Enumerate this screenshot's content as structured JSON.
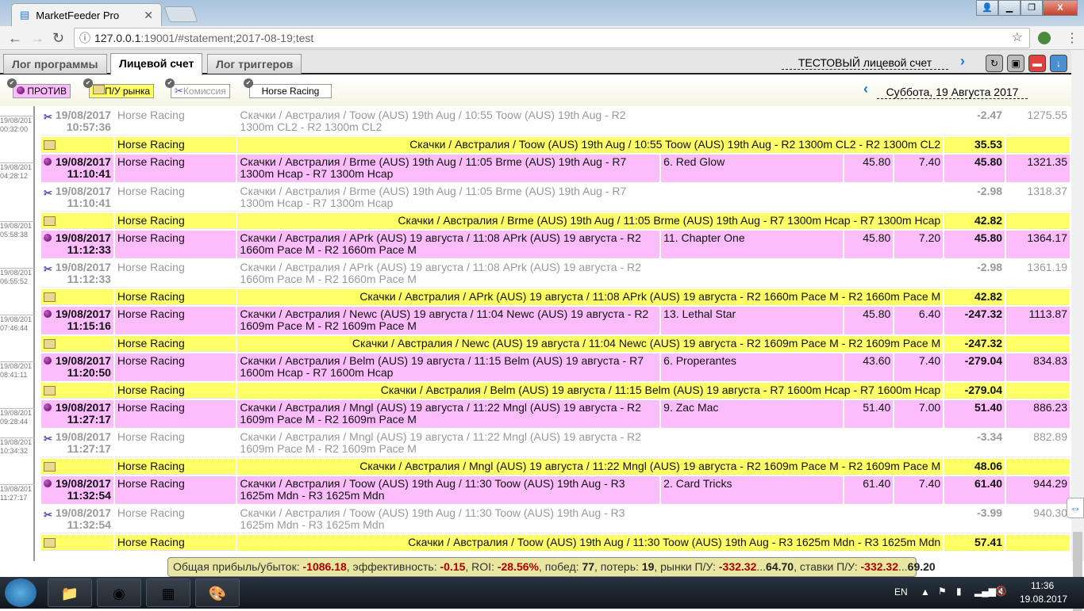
{
  "browser": {
    "tab_title": "MarketFeeder Pro",
    "url_host": "127.0.0.1",
    "url_rest": ":19001/#statement;2017-08-19;test"
  },
  "app_tabs": [
    "Лог программы",
    "Лицевой счет",
    "Лог триггеров"
  ],
  "account_label": "ТЕСТОВЫЙ лицевой счет",
  "filters": {
    "lay": "ПРОТИВ",
    "market_pl": "П/У рынка",
    "commission": "Комиссия",
    "sport": "Horse Racing"
  },
  "date_label": "Суббота, 19 Августа 2017",
  "rows": [
    {
      "type": "comm",
      "side": [
        "19/08/201",
        "00:32:00"
      ],
      "date": "19/08/2017",
      "time": "10:57:36",
      "sport": "Horse Racing",
      "market": "Скачки / Австралия / Toow (AUS) 19th Aug / 10:55 Toow (AUS) 19th Aug - R2 1300m CL2 - R2 1300m CL2",
      "selection": "",
      "price": "",
      "odds": "",
      "pnl": "-2.47",
      "balance": "1275.55"
    },
    {
      "type": "mkt",
      "sport": "Horse Racing",
      "market": "Скачки / Австралия / Toow (AUS) 19th Aug / 10:55 Toow (AUS) 19th Aug - R2 1300m CL2 - R2 1300m CL2",
      "pnl": "35.53"
    },
    {
      "type": "bet",
      "side": [
        "19/08/201",
        "04:28:12"
      ],
      "date": "19/08/2017",
      "time": "11:10:41",
      "sport": "Horse Racing",
      "market": "Скачки / Австралия / Brme (AUS) 19th Aug / 11:05 Brme (AUS) 19th Aug - R7 1300m Hcap - R7 1300m Hcap",
      "selection": "6. Red Glow",
      "price": "45.80",
      "odds": "7.40",
      "pnl": "45.80",
      "balance": "1321.35"
    },
    {
      "type": "comm",
      "date": "19/08/2017",
      "time": "11:10:41",
      "sport": "Horse Racing",
      "market": "Скачки / Австралия / Brme (AUS) 19th Aug / 11:05 Brme (AUS) 19th Aug - R7 1300m Hcap - R7 1300m Hcap",
      "selection": "",
      "price": "",
      "odds": "",
      "pnl": "-2.98",
      "balance": "1318.37"
    },
    {
      "type": "mkt",
      "side": [
        "19/08/201",
        "05:58:38"
      ],
      "sport": "Horse Racing",
      "market": "Скачки / Австралия / Brme (AUS) 19th Aug / 11:05 Brme (AUS) 19th Aug - R7 1300m Hcap - R7 1300m Hcap",
      "pnl": "42.82"
    },
    {
      "type": "bet",
      "date": "19/08/2017",
      "time": "11:12:33",
      "sport": "Horse Racing",
      "market": "Скачки / Австралия / APrk (AUS) 19 августа / 11:08 APrk (AUS) 19 августа - R2 1660m Pace M - R2 1660m Pace M",
      "selection": "11. Chapter One",
      "price": "45.80",
      "odds": "7.20",
      "pnl": "45.80",
      "balance": "1364.17"
    },
    {
      "type": "comm",
      "side": [
        "19/08/201",
        "06:55:52"
      ],
      "date": "19/08/2017",
      "time": "11:12:33",
      "sport": "Horse Racing",
      "market": "Скачки / Австралия / APrk (AUS) 19 августа / 11:08 APrk (AUS) 19 августа - R2 1660m Pace M - R2 1660m Pace M",
      "selection": "",
      "price": "",
      "odds": "",
      "pnl": "-2.98",
      "balance": "1361.19"
    },
    {
      "type": "mkt",
      "sport": "Horse Racing",
      "market": "Скачки / Австралия / APrk (AUS) 19 августа / 11:08 APrk (AUS) 19 августа - R2 1660m Pace M - R2 1660m Pace M",
      "pnl": "42.82"
    },
    {
      "type": "bet",
      "side": [
        "19/08/201",
        "07:46:44"
      ],
      "date": "19/08/2017",
      "time": "11:15:16",
      "sport": "Horse Racing",
      "market": "Скачки / Австралия / Newc (AUS) 19 августа / 11:04 Newc (AUS) 19 августа - R2 1609m Pace M - R2 1609m Pace M",
      "selection": "13. Lethal Star",
      "price": "45.80",
      "odds": "6.40",
      "pnl": "-247.32",
      "balance": "1113.87"
    },
    {
      "type": "mkt",
      "sport": "Horse Racing",
      "market": "Скачки / Австралия / Newc (AUS) 19 августа / 11:04 Newc (AUS) 19 августа - R2 1609m Pace M - R2 1609m Pace M",
      "pnl": "-247.32"
    },
    {
      "type": "bet",
      "side": [
        "19/08/201",
        "08:41:11"
      ],
      "date": "19/08/2017",
      "time": "11:20:50",
      "sport": "Horse Racing",
      "market": "Скачки / Австралия / Belm (AUS) 19 августа / 11:15 Belm (AUS) 19 августа - R7 1600m Hcap - R7 1600m Hcap",
      "selection": "6. Properantes",
      "price": "43.60",
      "odds": "7.40",
      "pnl": "-279.04",
      "balance": "834.83"
    },
    {
      "type": "mkt",
      "sport": "Horse Racing",
      "market": "Скачки / Австралия / Belm (AUS) 19 августа / 11:15 Belm (AUS) 19 августа - R7 1600m Hcap - R7 1600m Hcap",
      "pnl": "-279.04"
    },
    {
      "type": "bet",
      "side": [
        "19/08/201",
        "09:28:44"
      ],
      "date": "19/08/2017",
      "time": "11:27:17",
      "sport": "Horse Racing",
      "market": "Скачки / Австралия / Mngl (AUS) 19 августа / 11:22 Mngl (AUS) 19 августа - R2 1609m Pace M - R2 1609m Pace M",
      "selection": "9. Zac Mac",
      "price": "51.40",
      "odds": "7.00",
      "pnl": "51.40",
      "balance": "886.23"
    },
    {
      "type": "comm",
      "side": [
        "19/08/201",
        "10:34:32"
      ],
      "date": "19/08/2017",
      "time": "11:27:17",
      "sport": "Horse Racing",
      "market": "Скачки / Австралия / Mngl (AUS) 19 августа / 11:22 Mngl (AUS) 19 августа - R2 1609m Pace M - R2 1609m Pace M",
      "selection": "",
      "price": "",
      "odds": "",
      "pnl": "-3.34",
      "balance": "882.89"
    },
    {
      "type": "mkt",
      "sport": "Horse Racing",
      "market": "Скачки / Австралия / Mngl (AUS) 19 августа / 11:22 Mngl (AUS) 19 августа - R2 1609m Pace M - R2 1609m Pace M",
      "pnl": "48.06"
    },
    {
      "type": "bet",
      "side": [
        "19/08/201",
        "11:27:17"
      ],
      "date": "19/08/2017",
      "time": "11:32:54",
      "sport": "Horse Racing",
      "market": "Скачки / Австралия / Toow (AUS) 19th Aug / 11:30 Toow (AUS) 19th Aug - R3 1625m Mdn - R3 1625m Mdn",
      "selection": "2. Card Tricks",
      "price": "61.40",
      "odds": "7.40",
      "pnl": "61.40",
      "balance": "944.29"
    },
    {
      "type": "comm",
      "date": "19/08/2017",
      "time": "11:32:54",
      "sport": "Horse Racing",
      "market": "Скачки / Австралия / Toow (AUS) 19th Aug / 11:30 Toow (AUS) 19th Aug - R3 1625m Mdn - R3 1625m Mdn",
      "selection": "",
      "price": "",
      "odds": "",
      "pnl": "-3.99",
      "balance": "940.30"
    },
    {
      "type": "mkt",
      "sport": "Horse Racing",
      "market": "Скачки / Австралия / Toow (AUS) 19th Aug / 11:30 Toow (AUS) 19th Aug - R3 1625m Mdn - R3 1625m Mdn",
      "pnl": "57.41"
    }
  ],
  "summary": {
    "pl_label": "Общая прибыль/убыток: ",
    "pl": "-1086.18",
    "eff_label": ", эффективность: ",
    "eff": "-0.15",
    "roi_label": ", ROI: ",
    "roi": "-28.56%",
    "wins_label": ", побед: ",
    "wins": "77",
    "losses_label": ", потерь: ",
    "losses": "19",
    "mkts_label": ", рынки П/У: ",
    "mkts_min": "-332.32",
    "mkts_max": "64.70",
    "bets_label": ", ставки П/У: ",
    "bets_min": "-332.32",
    "bets_max": "69.20",
    "sep": "..."
  },
  "taskbar": {
    "lang": "EN",
    "time": "11:36",
    "date": "19.08.2017"
  },
  "colors": {
    "bet": "#fdbdfd",
    "market": "#ffff66",
    "positive": "#1a8a1a",
    "negative": "#a00000"
  }
}
